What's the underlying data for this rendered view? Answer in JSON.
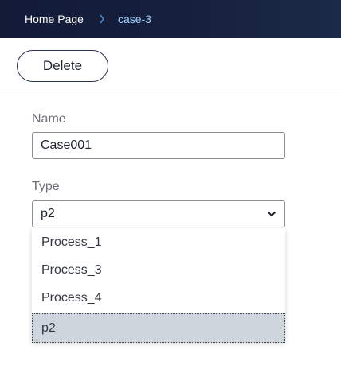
{
  "breadcrumb": {
    "home": "Home Page",
    "current": "case-3"
  },
  "toolbar": {
    "delete_label": "Delete"
  },
  "form": {
    "name_label": "Name",
    "name_value": "Case001",
    "type_label": "Type",
    "type_value": "p2",
    "type_options": [
      "Process_1",
      "Process_3",
      "Process_4",
      "p2"
    ],
    "selected_option": "p2"
  },
  "colors": {
    "topbar": "#16213f",
    "breadcrumb_current": "#9fd0ff",
    "selected_option_bg": "#cfd5dd"
  },
  "icons": {
    "breadcrumb_separator": "chevron-right-icon",
    "select_toggle": "chevron-down-icon"
  }
}
